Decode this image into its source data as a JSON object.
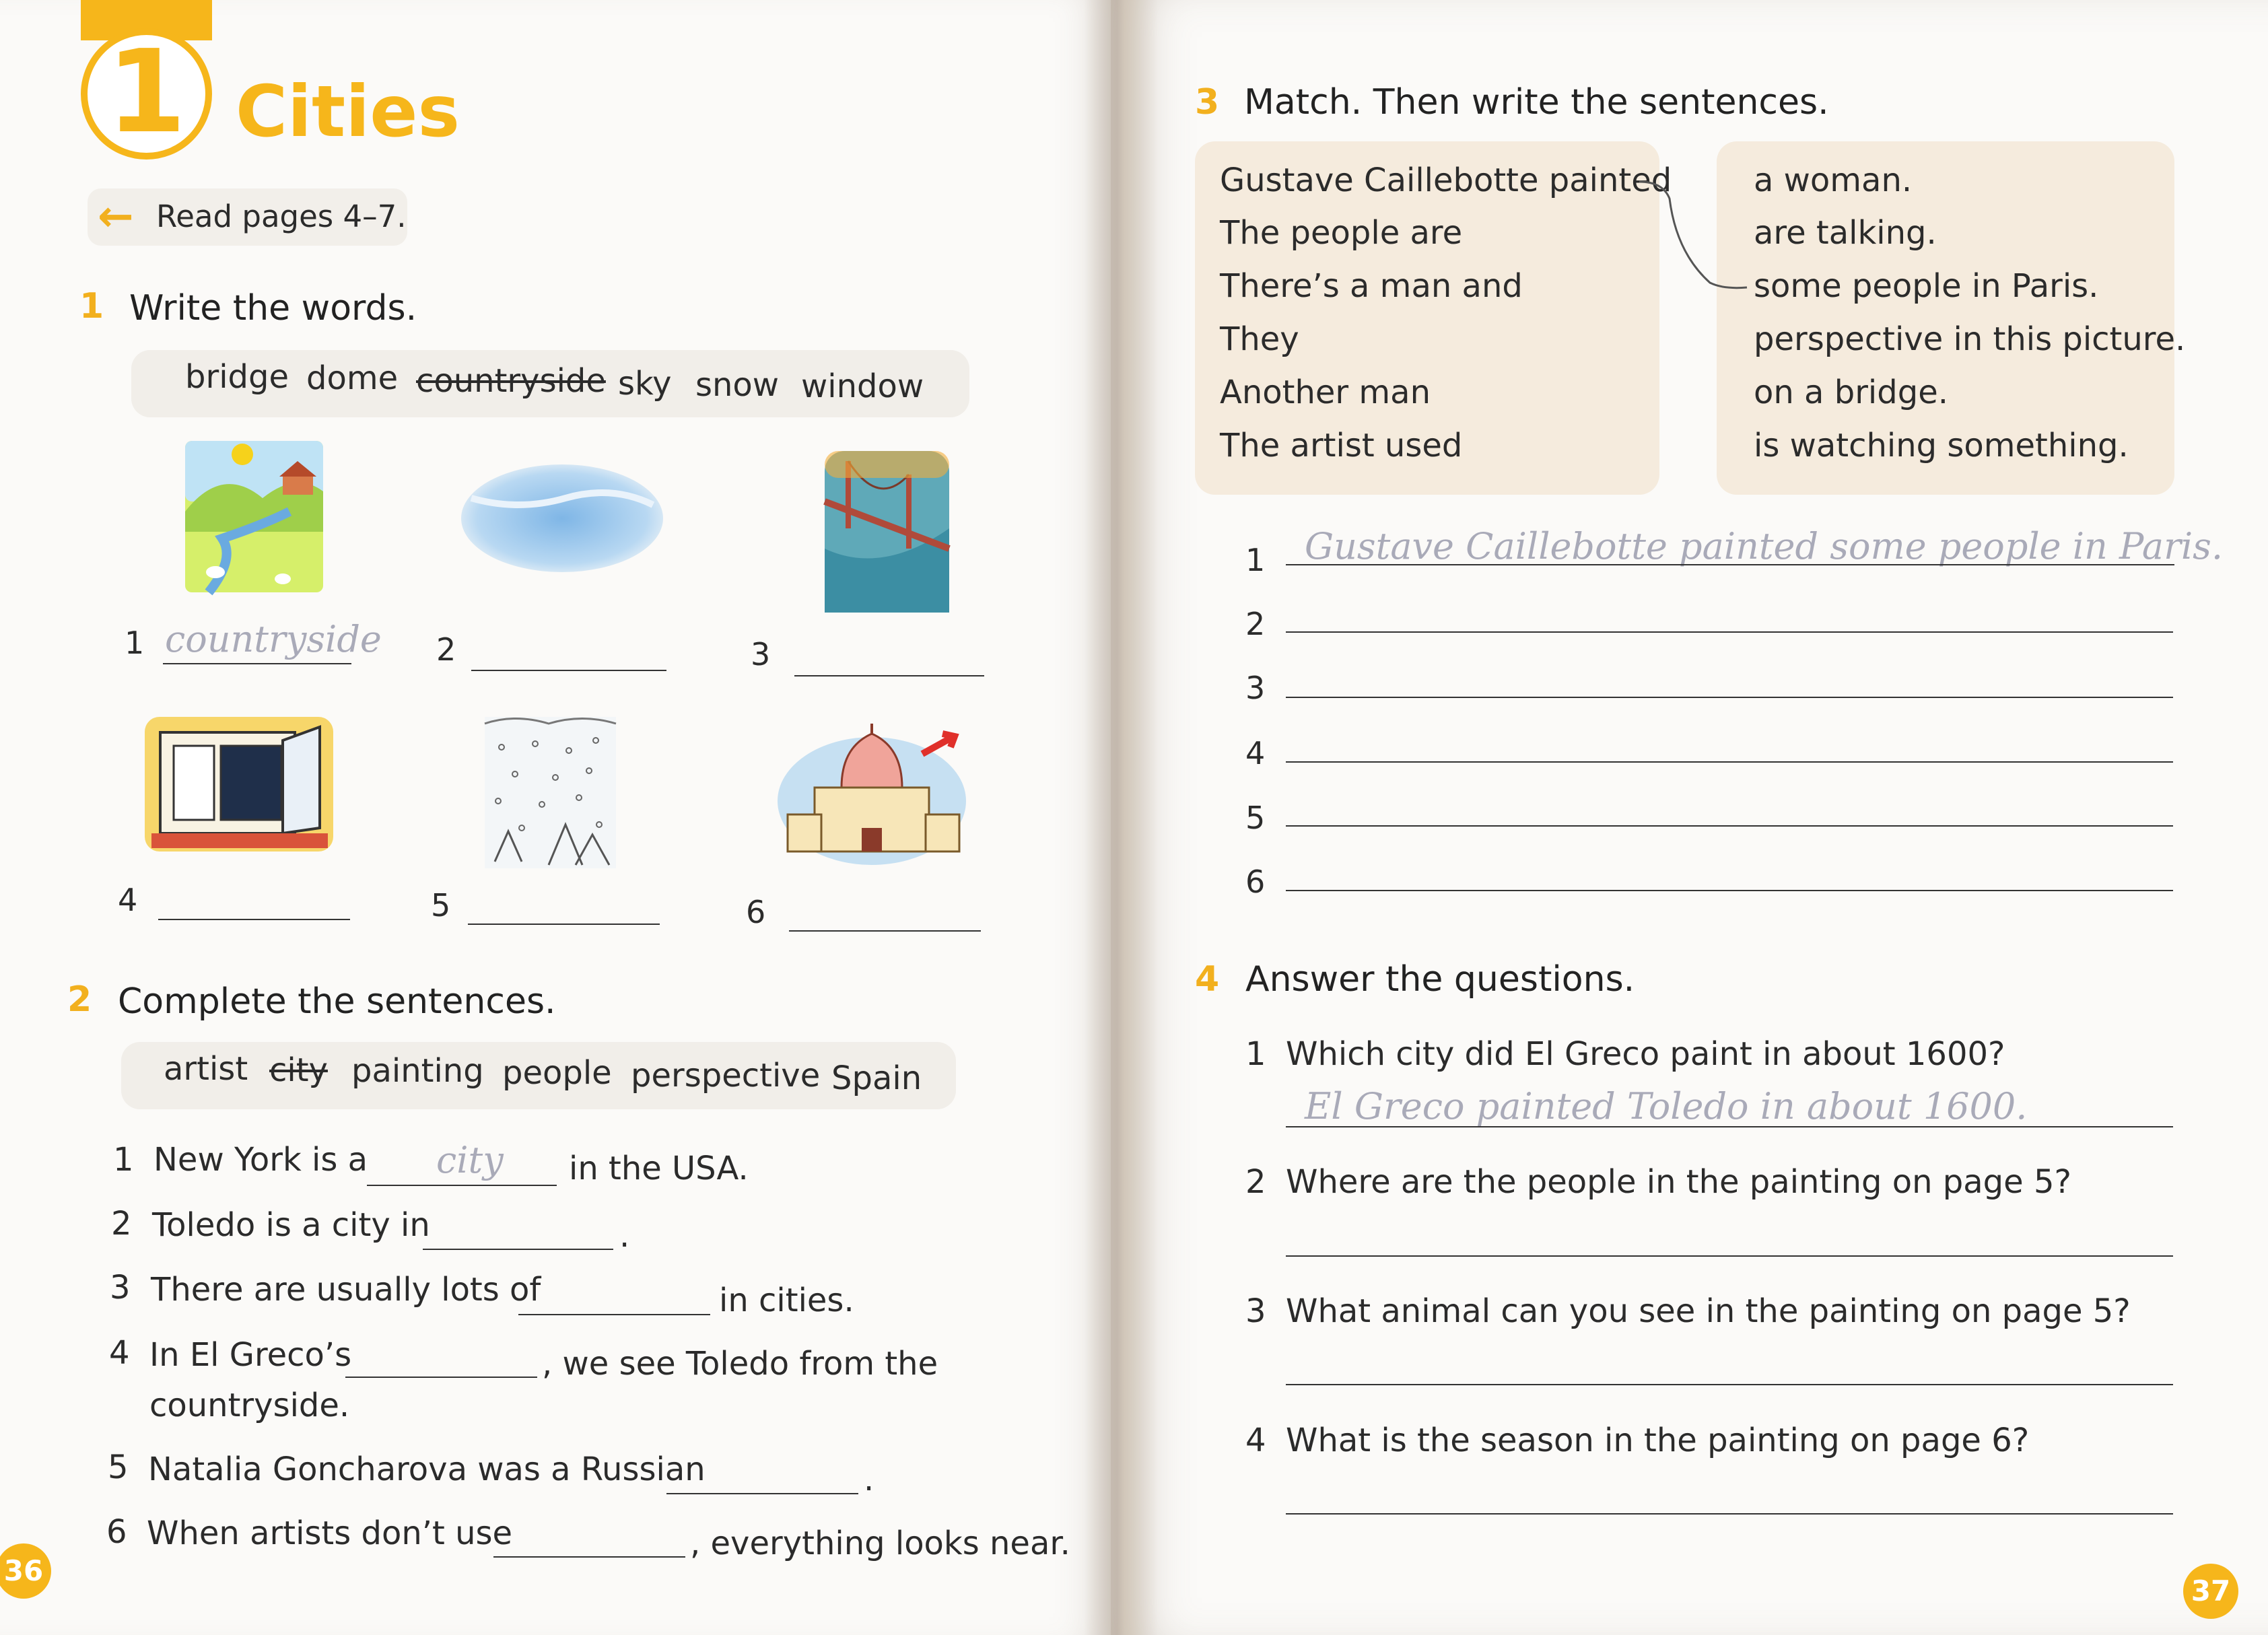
{
  "unit": {
    "number": "1",
    "title": "Cities"
  },
  "read_note": {
    "arrow": "arrow-left-icon",
    "text": "Read pages 4–7."
  },
  "exercise1": {
    "number": "1",
    "title": "Write the words.",
    "words": [
      "bridge",
      "dome",
      "countryside",
      "sky",
      "snow",
      "window"
    ],
    "struck_word": "countryside",
    "items": [
      {
        "num": "1",
        "picture": "countryside-picture",
        "answer": "countryside"
      },
      {
        "num": "2",
        "picture": "sky-picture",
        "answer": ""
      },
      {
        "num": "3",
        "picture": "bridge-picture",
        "answer": ""
      },
      {
        "num": "4",
        "picture": "window-picture",
        "answer": ""
      },
      {
        "num": "5",
        "picture": "snow-picture",
        "answer": ""
      },
      {
        "num": "6",
        "picture": "dome-picture",
        "answer": ""
      }
    ]
  },
  "exercise2": {
    "number": "2",
    "title": "Complete the sentences.",
    "words": [
      "artist",
      "city",
      "painting",
      "people",
      "perspective",
      "Spain"
    ],
    "struck_word": "city",
    "items": [
      {
        "num": "1",
        "before": "New York is a",
        "answer": "city",
        "after": "in the USA."
      },
      {
        "num": "2",
        "before": "Toledo is a city in",
        "answer": "",
        "after": "."
      },
      {
        "num": "3",
        "before": "There are usually lots of",
        "answer": "",
        "after": "in cities."
      },
      {
        "num": "4",
        "before": "In El Greco’s",
        "answer": "",
        "after": ", we see Toledo from the",
        "line2": "countryside."
      },
      {
        "num": "5",
        "before": "Natalia Goncharova was a Russian",
        "answer": "",
        "after": "."
      },
      {
        "num": "6",
        "before": "When artists don’t use",
        "answer": "",
        "after": ", everything looks near."
      }
    ]
  },
  "exercise3": {
    "number": "3",
    "title": "Match. Then write the sentences.",
    "left": [
      "Gustave Caillebotte painted",
      "The people are",
      "There’s a man and",
      "They",
      "Another man",
      "The artist used"
    ],
    "right": [
      "a woman.",
      "are talking.",
      "some people in Paris.",
      "perspective in this picture.",
      "on a bridge.",
      "is watching something."
    ],
    "lines": [
      {
        "num": "1",
        "answer": "Gustave Caillebotte painted some people in Paris."
      },
      {
        "num": "2",
        "answer": ""
      },
      {
        "num": "3",
        "answer": ""
      },
      {
        "num": "4",
        "answer": ""
      },
      {
        "num": "5",
        "answer": ""
      },
      {
        "num": "6",
        "answer": ""
      }
    ]
  },
  "exercise4": {
    "number": "4",
    "title": "Answer the questions.",
    "questions": [
      {
        "num": "1",
        "text": "Which city did El Greco paint in about 1600?",
        "answer": "El Greco painted Toledo in about 1600."
      },
      {
        "num": "2",
        "text": "Where are the people in the painting on page 5?",
        "answer": ""
      },
      {
        "num": "3",
        "text": "What animal can you see in the painting on page 5?",
        "answer": ""
      },
      {
        "num": "4",
        "text": "What is the season in the painting on page 6?",
        "answer": ""
      }
    ]
  },
  "page_numbers": {
    "left": "36",
    "right": "37"
  },
  "colors": {
    "accent": "#f6b61b",
    "match_box": "#f5ebdd",
    "word_box": "#f1eee9",
    "handwriting": "#a9aab8"
  }
}
